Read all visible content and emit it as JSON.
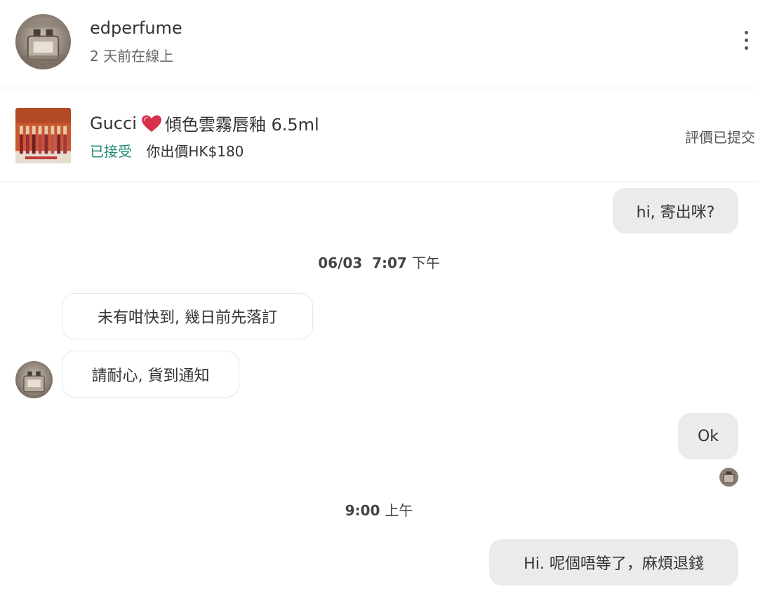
{
  "header": {
    "username": "edperfume",
    "last_seen": "2 天前在線上",
    "avatar_icon": "perfume-bottle-avatar",
    "more_icon": "vertical-ellipsis-icon"
  },
  "listing": {
    "brand": "Gucci",
    "heart_icon": "red-heart-icon",
    "name": "傾色雲霧唇釉 6.5ml",
    "status": "已接受",
    "offer": "你出價HK$180",
    "review_status": "評價已提交",
    "status_color": "#1f8a70"
  },
  "messages": [
    {
      "direction": "out",
      "text": "hi, 寄出咪?"
    },
    {
      "type": "timestamp",
      "date": "06/03",
      "time": "7:07",
      "period": "下午"
    },
    {
      "direction": "in",
      "text": "未有咁快到, 幾日前先落訂"
    },
    {
      "direction": "in",
      "text": "請耐心, 貨到通知"
    },
    {
      "direction": "out",
      "text": "Ok"
    },
    {
      "type": "timestamp",
      "time": "9:00",
      "period": "上午"
    },
    {
      "direction": "out",
      "text": "Hi. 呢個唔等了，麻煩退錢"
    }
  ],
  "colors": {
    "outgoing_bubble": "#ebebeb",
    "incoming_bubble": "#ffffff",
    "divider": "#e8e8e8"
  }
}
